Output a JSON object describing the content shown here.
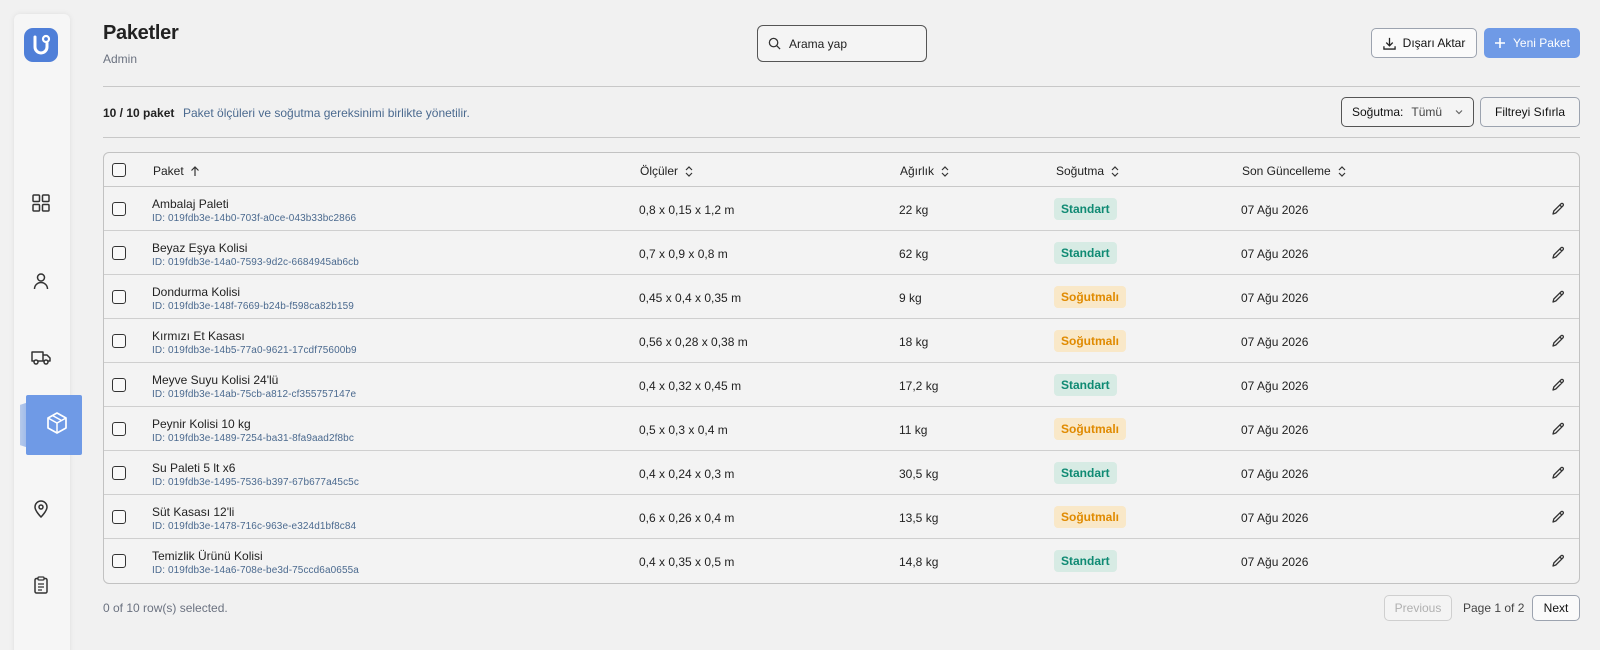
{
  "header": {
    "title": "Paketler",
    "subtitle": "Admin"
  },
  "search": {
    "placeholder": "Arama yap"
  },
  "actions": {
    "export_label": "Dışarı Aktar",
    "new_label": "Yeni Paket"
  },
  "summary": {
    "count": "10 / 10 paket",
    "description": "Paket ölçüleri ve soğutma gereksinimi birlikte yönetilir."
  },
  "filter": {
    "label": "Soğutma:",
    "value": "Tümü",
    "reset_label": "Filtreyi Sıfırla"
  },
  "columns": {
    "paket": "Paket",
    "olculer": "Ölçüler",
    "agirlik": "Ağırlık",
    "sogutma": "Soğutma",
    "guncelleme": "Son Güncelleme"
  },
  "sidebar": {
    "icons": [
      "grid-icon",
      "user-icon",
      "truck-icon",
      "package-icon",
      "map-pin-icon",
      "clipboard-icon"
    ],
    "active": "package-icon"
  },
  "colors": {
    "accent": "#6f9ae6",
    "standard_text": "#0f8a73",
    "standard_bg": "#d7ebe4",
    "cold_text": "#e08a00",
    "cold_bg": "#f9e8c8"
  },
  "rows": [
    {
      "name": "Ambalaj Paleti",
      "id": "ID: 019fdb3e-14b0-703f-a0ce-043b33bc2866",
      "dims": "0,8 x 0,15 x 1,2 m",
      "weight": "22 kg",
      "cooling": "Standart",
      "cold": false,
      "date": "07 Ağu 2026"
    },
    {
      "name": "Beyaz Eşya Kolisi",
      "id": "ID: 019fdb3e-14a0-7593-9d2c-6684945ab6cb",
      "dims": "0,7 x 0,9 x 0,8 m",
      "weight": "62 kg",
      "cooling": "Standart",
      "cold": false,
      "date": "07 Ağu 2026"
    },
    {
      "name": "Dondurma Kolisi",
      "id": "ID: 019fdb3e-148f-7669-b24b-f598ca82b159",
      "dims": "0,45 x 0,4 x 0,35 m",
      "weight": "9 kg",
      "cooling": "Soğutmalı",
      "cold": true,
      "date": "07 Ağu 2026"
    },
    {
      "name": "Kırmızı Et Kasası",
      "id": "ID: 019fdb3e-14b5-77a0-9621-17cdf75600b9",
      "dims": "0,56 x 0,28 x 0,38 m",
      "weight": "18 kg",
      "cooling": "Soğutmalı",
      "cold": true,
      "date": "07 Ağu 2026"
    },
    {
      "name": "Meyve Suyu Kolisi 24'lü",
      "id": "ID: 019fdb3e-14ab-75cb-a812-cf355757147e",
      "dims": "0,4 x 0,32 x 0,45 m",
      "weight": "17,2 kg",
      "cooling": "Standart",
      "cold": false,
      "date": "07 Ağu 2026"
    },
    {
      "name": "Peynir Kolisi 10 kg",
      "id": "ID: 019fdb3e-1489-7254-ba31-8fa9aad2f8bc",
      "dims": "0,5 x 0,3 x 0,4 m",
      "weight": "11 kg",
      "cooling": "Soğutmalı",
      "cold": true,
      "date": "07 Ağu 2026"
    },
    {
      "name": "Su Paleti 5 lt x6",
      "id": "ID: 019fdb3e-1495-7536-b397-67b677a45c5c",
      "dims": "0,4 x 0,24 x 0,3 m",
      "weight": "30,5 kg",
      "cooling": "Standart",
      "cold": false,
      "date": "07 Ağu 2026"
    },
    {
      "name": "Süt Kasası 12'li",
      "id": "ID: 019fdb3e-1478-716c-963e-e324d1bf8c84",
      "dims": "0,6 x 0,26 x 0,4 m",
      "weight": "13,5 kg",
      "cooling": "Soğutmalı",
      "cold": true,
      "date": "07 Ağu 2026"
    },
    {
      "name": "Temizlik Ürünü Kolisi",
      "id": "ID: 019fdb3e-14a6-708e-be3d-75ccd6a0655a",
      "dims": "0,4 x 0,35 x 0,5 m",
      "weight": "14,8 kg",
      "cooling": "Standart",
      "cold": false,
      "date": "07 Ağu 2026"
    }
  ],
  "footer": {
    "selected": "0 of 10 row(s) selected.",
    "prev_label": "Previous",
    "page": "Page 1 of 2",
    "next_label": "Next"
  }
}
